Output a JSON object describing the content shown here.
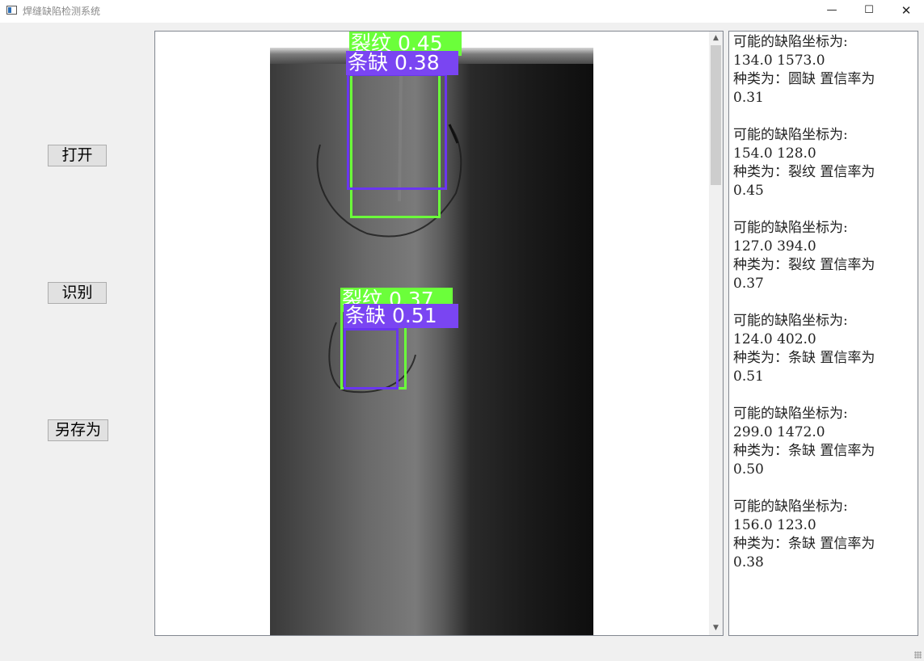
{
  "window": {
    "title": "焊缝缺陷检测系统",
    "minimize": "—",
    "maximize": "☐",
    "close": "✕"
  },
  "buttons": {
    "open": "打开",
    "detect": "识别",
    "save_as": "另存为"
  },
  "image": {
    "detections": [
      {
        "label": "裂纹 0.45",
        "color": "#6bff3a"
      },
      {
        "label": "条缺 0.38",
        "color": "#6a36f0"
      },
      {
        "label": "裂纹 0.37",
        "color": "#6bff3a"
      },
      {
        "label": "条缺 0.51",
        "color": "#6a36f0"
      }
    ]
  },
  "scrollbar": {
    "up": "▲",
    "down": "▼"
  },
  "results": [
    {
      "heading": "可能的缺陷坐标为:",
      "coords": "134.0 1573.0",
      "type_line": "种类为：圆缺 置信率为",
      "conf": "0.31"
    },
    {
      "heading": "可能的缺陷坐标为:",
      "coords": "154.0 128.0",
      "type_line": "种类为：裂纹 置信率为",
      "conf": "0.45"
    },
    {
      "heading": "可能的缺陷坐标为:",
      "coords": "127.0 394.0",
      "type_line": "种类为：裂纹 置信率为",
      "conf": "0.37"
    },
    {
      "heading": "可能的缺陷坐标为:",
      "coords": "124.0 402.0",
      "type_line": "种类为：条缺 置信率为",
      "conf": "0.51"
    },
    {
      "heading": "可能的缺陷坐标为:",
      "coords": "299.0 1472.0",
      "type_line": "种类为：条缺 置信率为",
      "conf": "0.50"
    },
    {
      "heading": "可能的缺陷坐标为:",
      "coords": "156.0 123.0",
      "type_line": "种类为：条缺 置信率为",
      "conf": "0.38"
    }
  ]
}
